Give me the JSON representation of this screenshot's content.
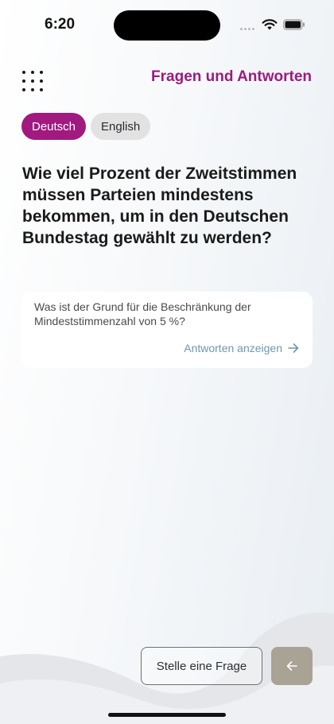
{
  "status_bar": {
    "time": "6:20"
  },
  "header": {
    "title": "Fragen und Antworten",
    "menu_icon": "grid-dots-icon"
  },
  "languages": [
    {
      "label": "Deutsch",
      "selected": true
    },
    {
      "label": "English",
      "selected": false
    }
  ],
  "question": {
    "text": "Wie viel Prozent der Zweitstimmen müssen Parteien mindestens bekommen, um in den Deutschen Bundestag gewählt zu werden?"
  },
  "card": {
    "text": "Was ist der Grund für die Beschränkung der Mindeststimmenzahl von 5 %?",
    "link_label": "Antworten anzeigen",
    "link_icon": "arrow-right-icon"
  },
  "footer": {
    "ask_button_label": "Stelle eine Frage",
    "back_icon": "arrow-left-icon"
  },
  "colors": {
    "brand": "#9b1b7f",
    "pill_active": "#a11a80",
    "link": "#6e98ad",
    "back_button": "#a9a395"
  }
}
